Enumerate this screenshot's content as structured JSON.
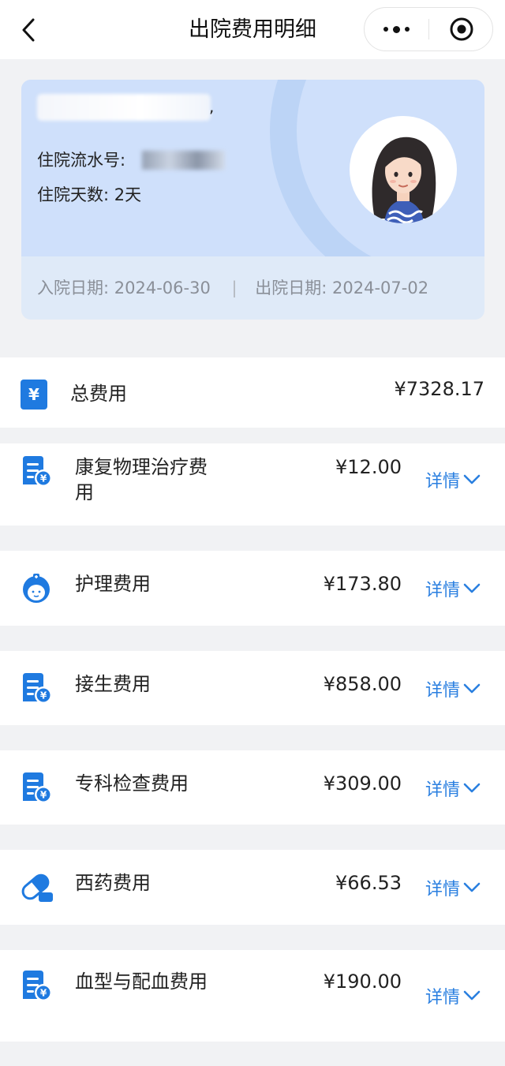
{
  "header": {
    "title": "出院费用明细"
  },
  "patient": {
    "serial_label": "住院流水号:",
    "days_label": "住院天数:",
    "days_value": "2天",
    "admit_label": "入院日期:",
    "admit_date": "2024-06-30",
    "separator": "|",
    "discharge_label": "出院日期:",
    "discharge_date": "2024-07-02"
  },
  "total": {
    "icon_glyph": "¥",
    "label": "总费用",
    "amount": "¥7328.17"
  },
  "detail_label": "详情",
  "fees": [
    {
      "label": "康复物理治疗费用",
      "amount": "¥12.00",
      "icon": "bill-icon"
    },
    {
      "label": "护理费用",
      "amount": "¥173.80",
      "icon": "nurse-icon"
    },
    {
      "label": "接生费用",
      "amount": "¥858.00",
      "icon": "bill-icon"
    },
    {
      "label": "专科检查费用",
      "amount": "¥309.00",
      "icon": "bill-icon"
    },
    {
      "label": "西药费用",
      "amount": "¥66.53",
      "icon": "pill-icon"
    },
    {
      "label": "血型与配血费用",
      "amount": "¥190.00",
      "icon": "bill-icon"
    }
  ],
  "colors": {
    "accent": "#1f7ae0",
    "link": "#2a7fe0",
    "card_bg": "#cfe0fb"
  }
}
